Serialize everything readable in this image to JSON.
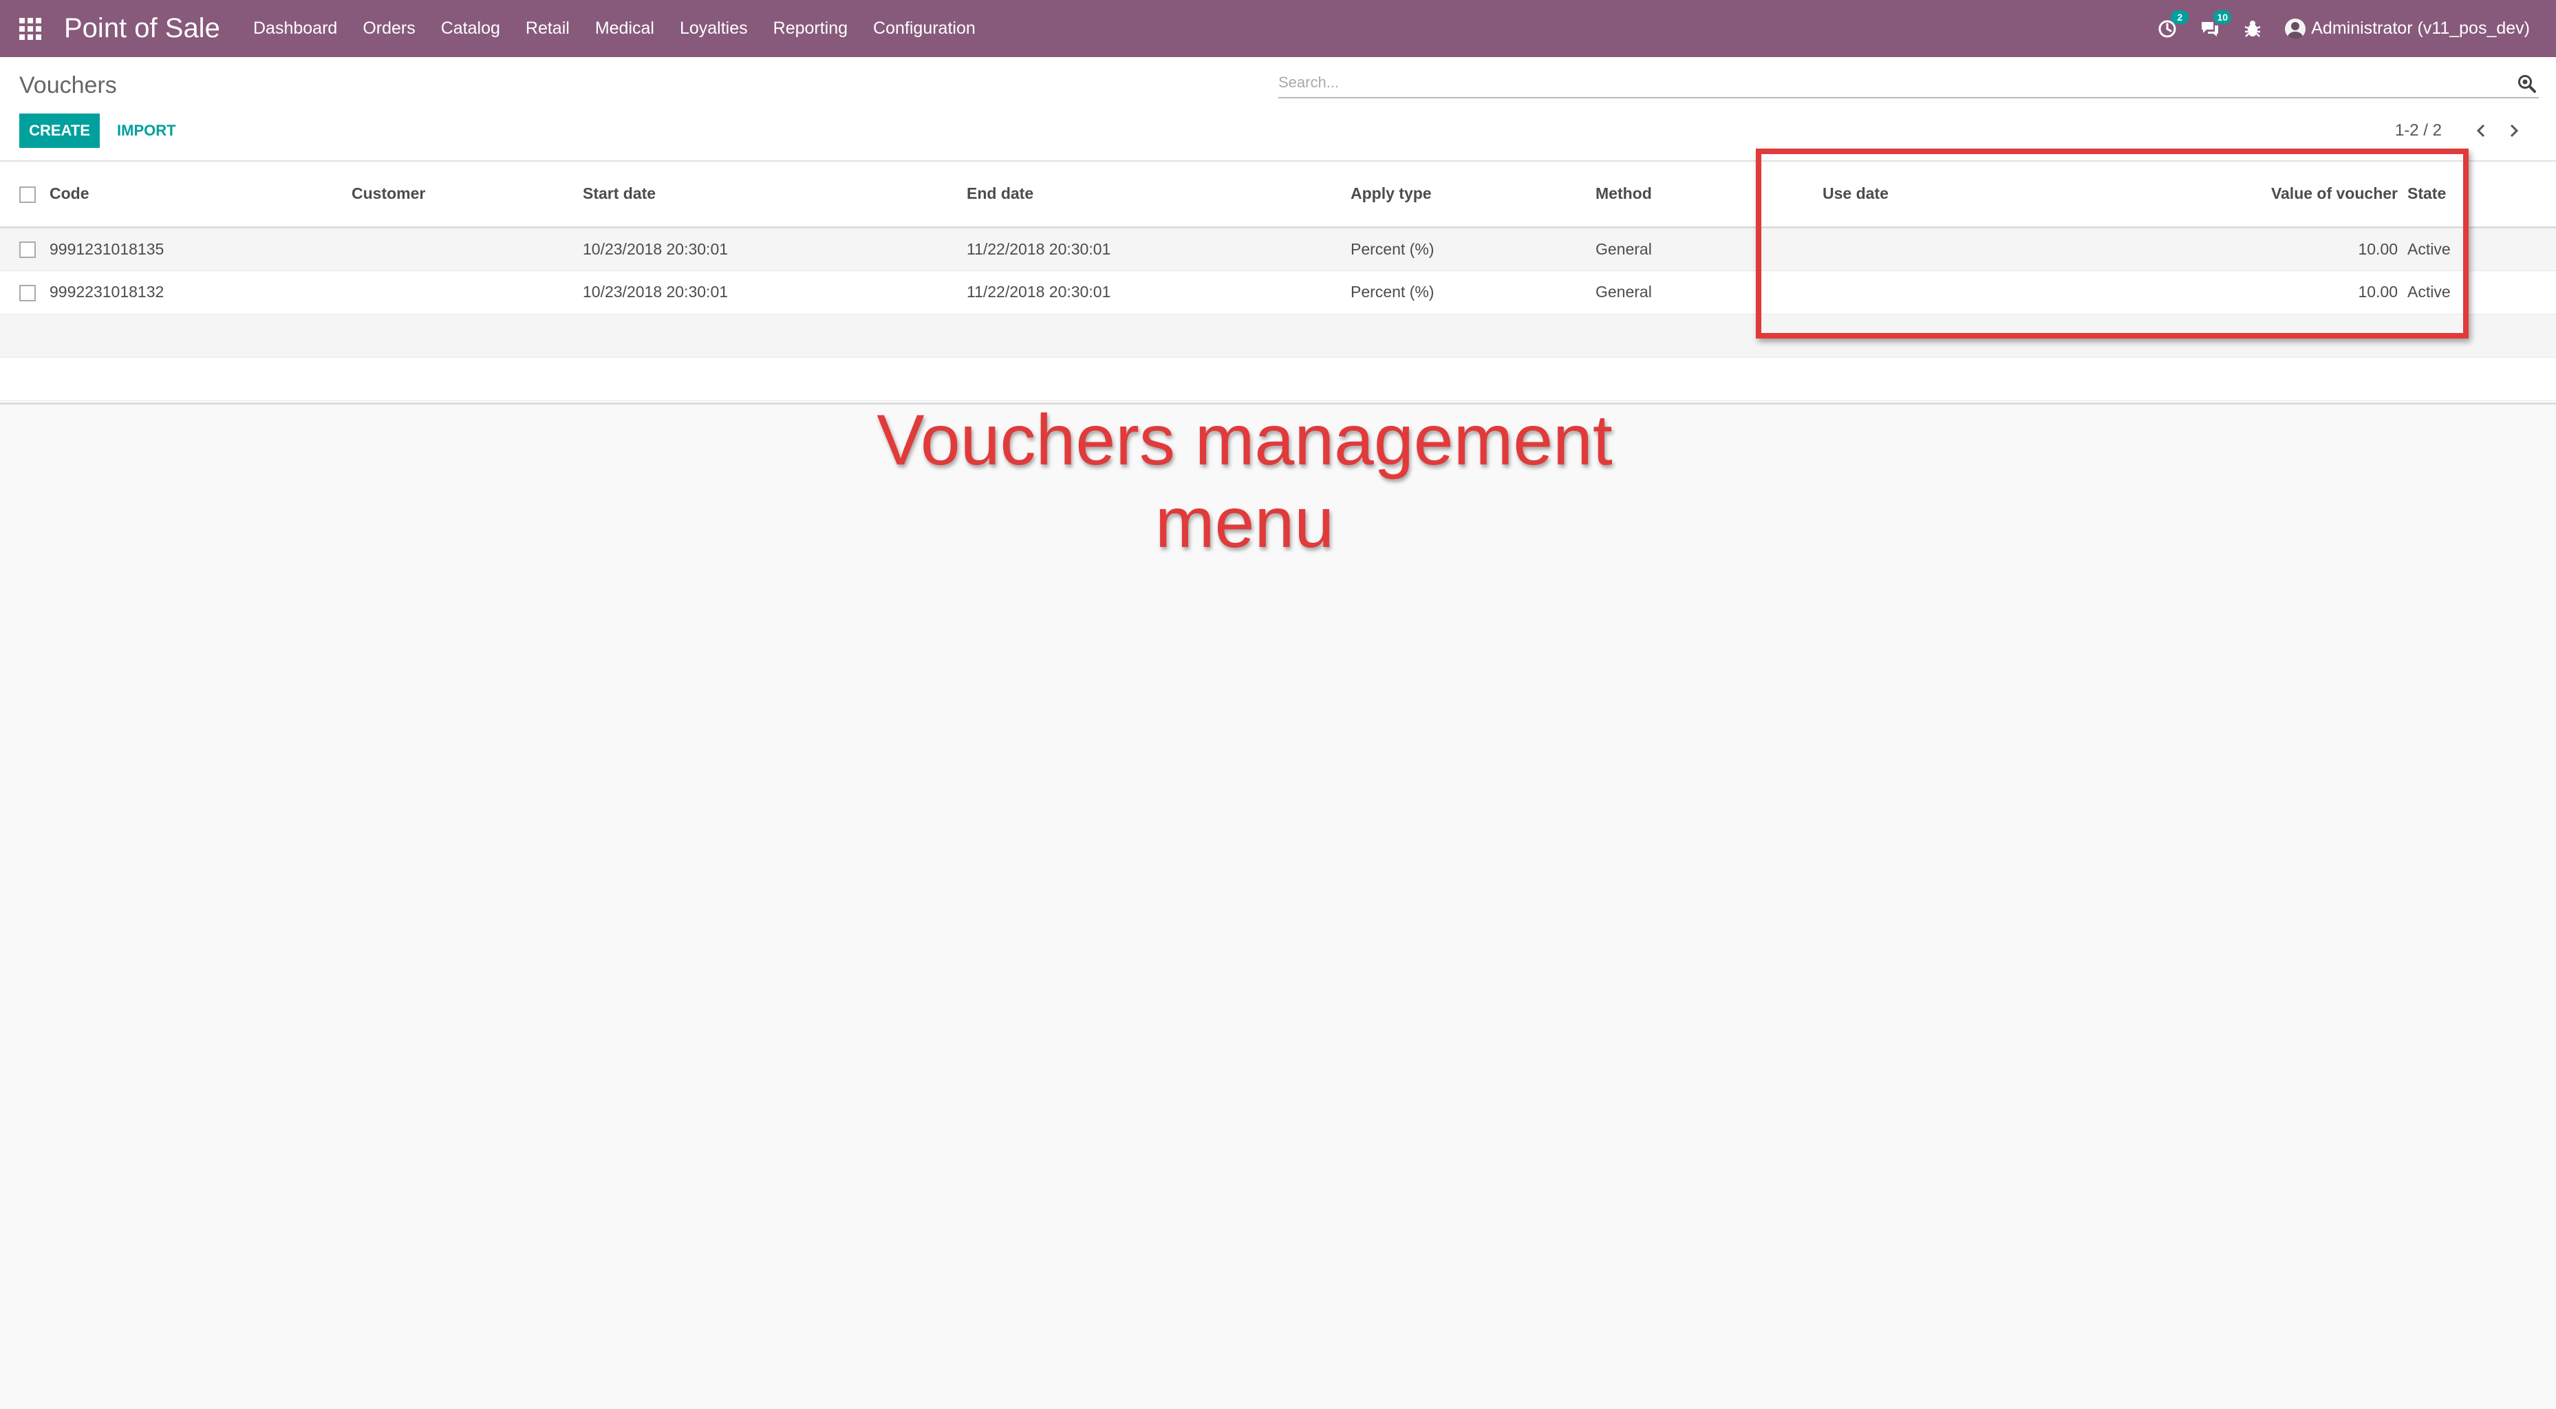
{
  "navbar": {
    "app_title": "Point of Sale",
    "menu": [
      "Dashboard",
      "Orders",
      "Catalog",
      "Retail",
      "Medical",
      "Loyalties",
      "Reporting",
      "Configuration"
    ],
    "activity_badge": "2",
    "messages_badge": "10",
    "user": "Administrator (v11_pos_dev)"
  },
  "control_panel": {
    "title": "Vouchers",
    "search_placeholder": "Search...",
    "create_label": "CREATE",
    "import_label": "IMPORT",
    "pager": "1-2 / 2"
  },
  "table": {
    "columns": [
      "Code",
      "Customer",
      "Start date",
      "End date",
      "Apply type",
      "Method",
      "Use date",
      "Value of voucher",
      "State"
    ],
    "rows": [
      {
        "code": "9991231018135",
        "customer": "",
        "start_date": "10/23/2018 20:30:01",
        "end_date": "11/22/2018 20:30:01",
        "apply_type": "Percent (%)",
        "method": "General",
        "use_date": "",
        "value": "10.00",
        "state": "Active"
      },
      {
        "code": "9992231018132",
        "customer": "",
        "start_date": "10/23/2018 20:30:01",
        "end_date": "11/22/2018 20:30:01",
        "apply_type": "Percent (%)",
        "method": "General",
        "use_date": "",
        "value": "10.00",
        "state": "Active"
      }
    ]
  },
  "annotation": {
    "line1": "Vouchers management",
    "line2": "menu"
  },
  "colors": {
    "navbar": "#875a7b",
    "primary": "#00a09d",
    "annotation": "#e03a3a"
  }
}
